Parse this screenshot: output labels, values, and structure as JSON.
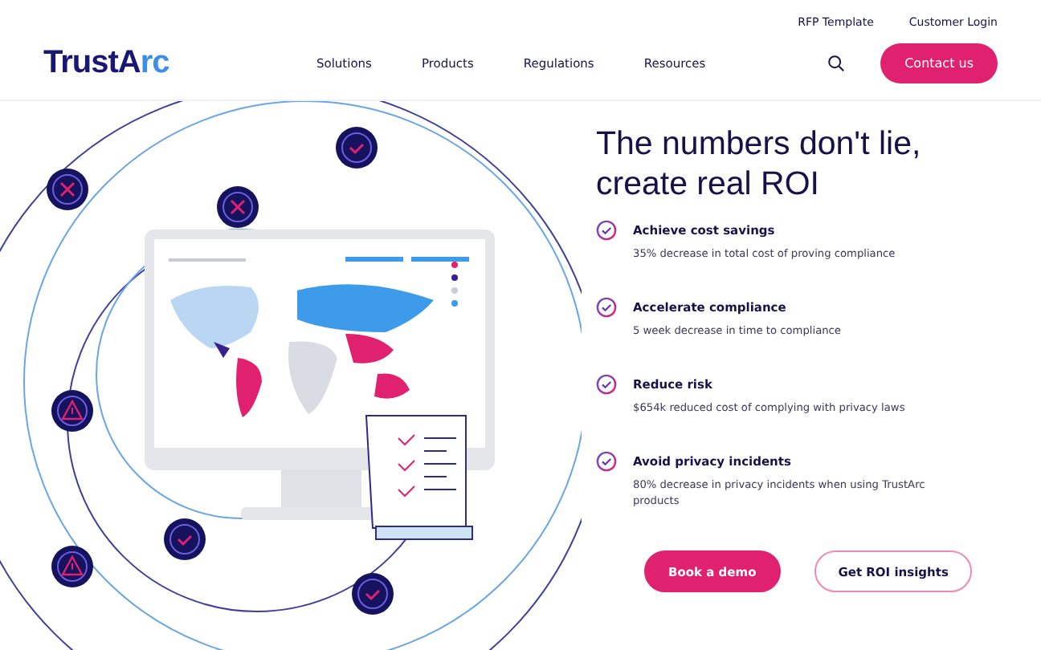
{
  "top_links": [
    "RFP Template",
    "Customer Login"
  ],
  "logo": {
    "main": "TrustA",
    "accent": "rc"
  },
  "nav": [
    "Solutions",
    "Products",
    "Regulations",
    "Resources"
  ],
  "contact_button": "Contact us",
  "hero": {
    "title_lines": [
      "The numbers don't lie,",
      "create real ROI"
    ],
    "features": [
      {
        "title": "Achieve cost savings",
        "text": "35% decrease in total cost of proving compliance"
      },
      {
        "title": "Accelerate compliance",
        "text": "5 week decrease in time to compliance"
      },
      {
        "title": "Reduce risk",
        "text": "$654k reduced cost of complying with privacy laws"
      },
      {
        "title": "Avoid privacy incidents",
        "text": "80% decrease in privacy incidents when using TrustArc products"
      }
    ],
    "buttons": [
      {
        "label": "Book a demo",
        "kind": "primary"
      },
      {
        "label": "Get ROI insights",
        "kind": "outline"
      }
    ]
  }
}
